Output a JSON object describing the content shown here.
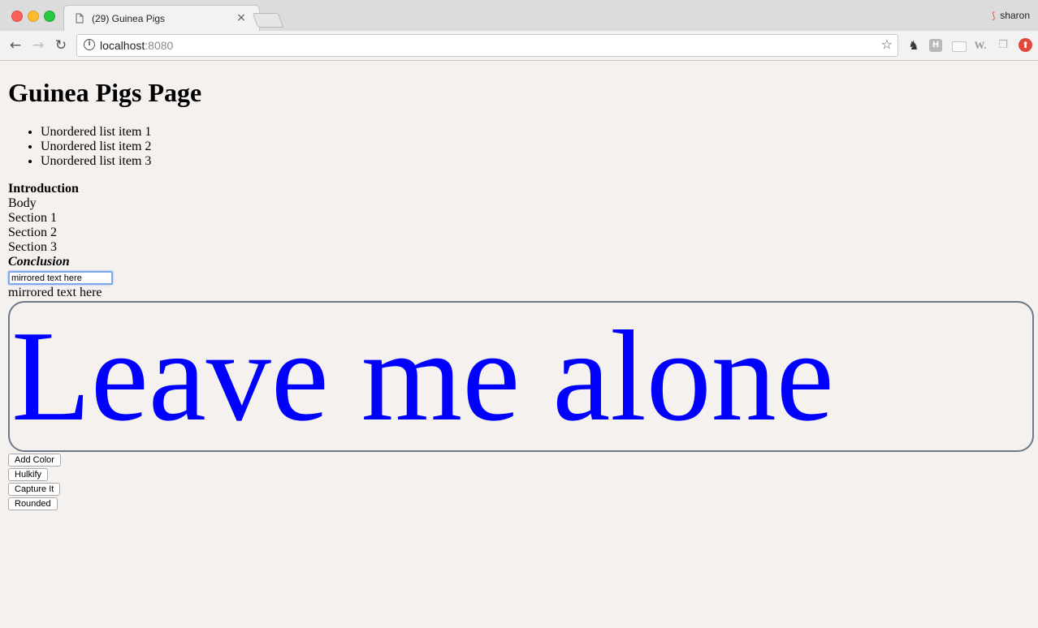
{
  "browser": {
    "tab_title": "(29) Guinea Pigs",
    "tab_close": "×",
    "profile_name": "sharon",
    "url_host": "localhost",
    "url_port": ":8080"
  },
  "page": {
    "title": "Guinea Pigs Page",
    "list_items": [
      "Unordered list item 1",
      "Unordered list item 2",
      "Unordered list item 3"
    ],
    "intro": "Introduction",
    "body": "Body",
    "section1": "Section 1",
    "section2": "Section 2",
    "section3": "Section 3",
    "conclusion": "Conclusion",
    "mirror_input_value": "mirrored text here",
    "mirror_output": "mirrored text here",
    "big_text": "Leave me alone",
    "big_text_color": "#0000ff",
    "buttons": {
      "add_color": "Add Color",
      "hulkify": "Hulkify",
      "capture": "Capture It",
      "rounded": "Rounded"
    }
  }
}
